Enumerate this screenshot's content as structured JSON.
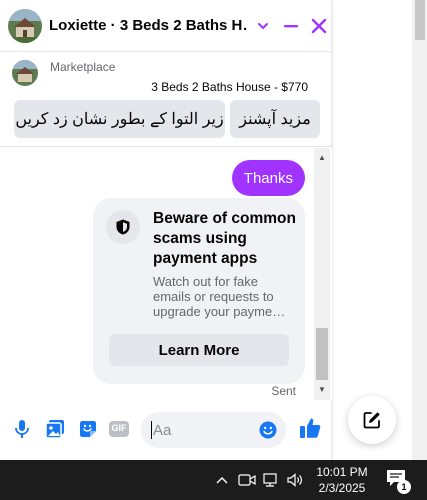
{
  "chat": {
    "title": "Loxiette · 3 Beds 2 Baths H…",
    "listing": {
      "source": "Marketplace",
      "price_line": "3 Beds 2 Baths House - $770",
      "quick_replies": [
        "مزید آپشنز",
        "زیر التوا کے بطور نشان زد کریں"
      ]
    },
    "messages": {
      "sent_text": "Thanks",
      "warning": {
        "title": "Beware of common scams using payment apps",
        "body": "Watch out for fake emails or requests to upgrade your payme…",
        "button": "Learn More"
      },
      "status": "Sent"
    },
    "composer": {
      "placeholder": "Aa",
      "gif_label": "GIF"
    },
    "accent_color": "#a033ff",
    "icons": [
      "minimize-icon",
      "close-icon",
      "chevron-down-icon",
      "shield-icon",
      "microphone-icon",
      "photo-icon",
      "sticker-icon",
      "gif-icon",
      "emoji-icon",
      "like-icon",
      "new-message-icon"
    ]
  },
  "taskbar": {
    "time": "10:01 PM",
    "date": "2/3/2025",
    "notification_count": "1"
  }
}
